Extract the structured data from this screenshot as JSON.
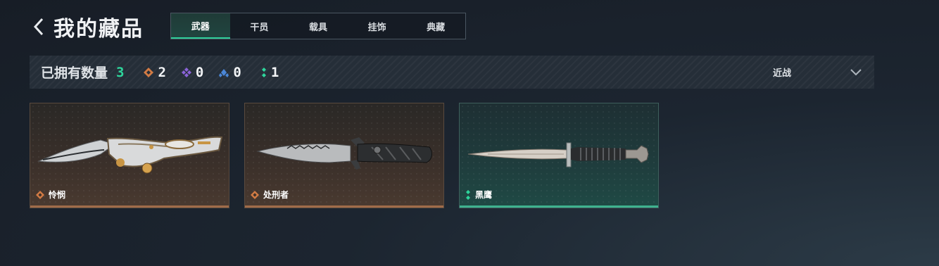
{
  "header": {
    "title": "我的藏品",
    "back_icon": "chevron-left-icon"
  },
  "tabs": [
    {
      "label": "武器",
      "active": true
    },
    {
      "label": "干员",
      "active": false
    },
    {
      "label": "载具",
      "active": false
    },
    {
      "label": "挂饰",
      "active": false
    },
    {
      "label": "典藏",
      "active": false
    }
  ],
  "filter": {
    "owned_label": "已拥有数量",
    "owned_count": "3",
    "rarities": [
      {
        "icon": "orange-diamond-icon",
        "color": "#d27b44",
        "count": "2"
      },
      {
        "icon": "purple-diamond-icon",
        "color": "#8a63d8",
        "count": "0"
      },
      {
        "icon": "blue-triangle-icon",
        "color": "#4a86d6",
        "count": "0"
      },
      {
        "icon": "green-dots-icon",
        "color": "#2ed69c",
        "count": "1"
      }
    ],
    "dropdown_value": "近战",
    "dropdown_icon": "chevron-down-icon"
  },
  "cards": [
    {
      "name": "怜悯",
      "rarity_color": "#d27b44",
      "icon": "orange-diamond-icon"
    },
    {
      "name": "处刑者",
      "rarity_color": "#d27b44",
      "icon": "orange-diamond-icon"
    },
    {
      "name": "黑鹰",
      "rarity_color": "#2ed69c",
      "icon": "green-dots-icon"
    }
  ],
  "colors": {
    "accent": "#2ecf9a"
  }
}
